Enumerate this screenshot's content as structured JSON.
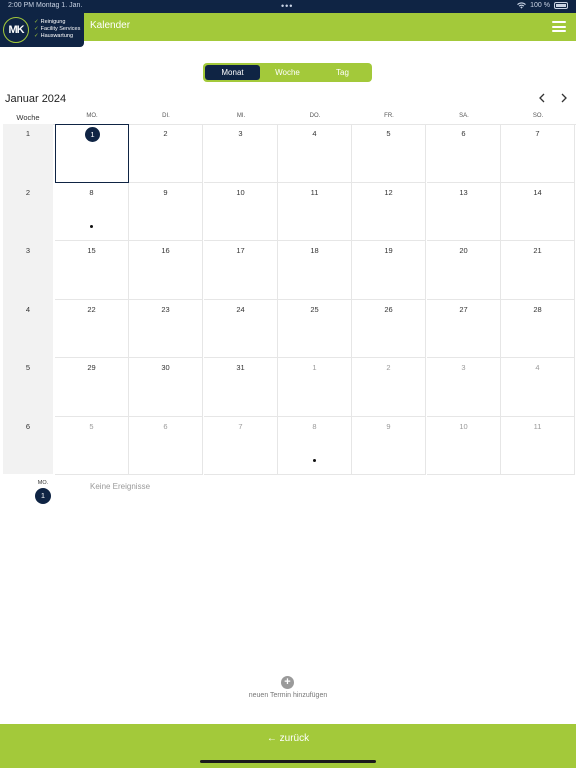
{
  "status_bar": {
    "time": "2:00 PM Montag 1. Jan.",
    "dots": "•••",
    "battery": "100 %",
    "wifi_icon": "wifi-icon",
    "battery_icon": "battery-icon"
  },
  "header": {
    "title": "Kalender",
    "logo": {
      "initials": "MK",
      "lines": [
        "Reinigung",
        "Facility Services",
        "Hauswartung"
      ]
    },
    "menu_icon": "hamburger-icon"
  },
  "view_switch": {
    "options": [
      "Monat",
      "Woche",
      "Tag"
    ],
    "selected": "Monat"
  },
  "calendar": {
    "month_label": "Januar 2024",
    "week_header": "Woche",
    "day_names": [
      "MO.",
      "DI.",
      "MI.",
      "DO.",
      "FR.",
      "SA.",
      "SO."
    ],
    "weeks": [
      {
        "num": "1",
        "days": [
          "1",
          "2",
          "3",
          "4",
          "5",
          "6",
          "7"
        ]
      },
      {
        "num": "2",
        "days": [
          "8",
          "9",
          "10",
          "11",
          "12",
          "13",
          "14"
        ]
      },
      {
        "num": "3",
        "days": [
          "15",
          "16",
          "17",
          "18",
          "19",
          "20",
          "21"
        ]
      },
      {
        "num": "4",
        "days": [
          "22",
          "23",
          "24",
          "25",
          "26",
          "27",
          "28"
        ]
      },
      {
        "num": "5",
        "days": [
          "29",
          "30",
          "31",
          "1",
          "2",
          "3",
          "4"
        ]
      },
      {
        "num": "6",
        "days": [
          "5",
          "6",
          "7",
          "8",
          "9",
          "10",
          "11"
        ]
      }
    ],
    "selected_day": "1",
    "days_with_events": [
      "8 Jan",
      "8 Feb"
    ]
  },
  "selected_day_panel": {
    "day_label": "MO.",
    "day_number": "1",
    "empty_text": "Keine Ereignisse"
  },
  "add_appointment": {
    "icon": "plus-icon",
    "label": "neuen Termin hinzufügen"
  },
  "footer": {
    "back_label": "zurück",
    "back_icon": "arrow-left-icon"
  },
  "colors": {
    "brand_green": "#a3c93a",
    "brand_navy": "#0f2444"
  }
}
